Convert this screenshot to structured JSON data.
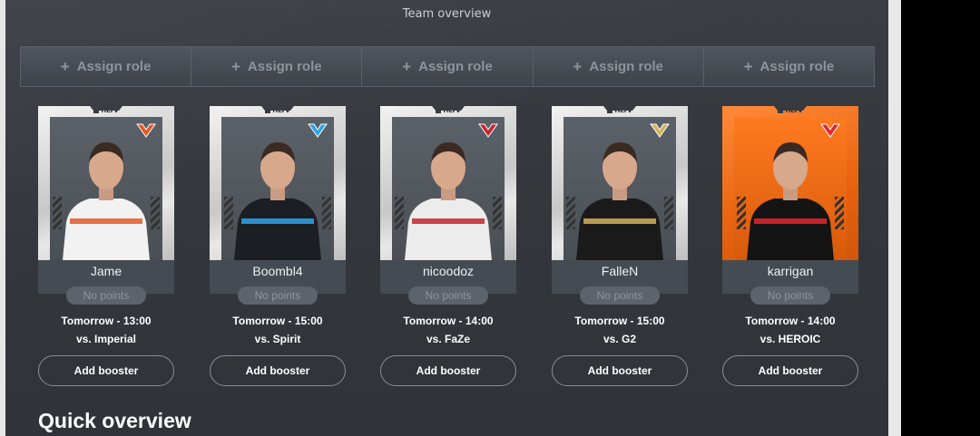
{
  "panel": {
    "title": "Team overview"
  },
  "roles": [
    {
      "label": "Assign role"
    },
    {
      "label": "Assign role"
    },
    {
      "label": "Assign role"
    },
    {
      "label": "Assign role"
    },
    {
      "label": "Assign role"
    }
  ],
  "players": [
    {
      "name": "Jame",
      "points": "No points",
      "time": "Tomorrow - 13:00",
      "opponent": "vs. Imperial",
      "booster": "Add booster",
      "logo": "virtus-pro-logo-icon",
      "badge": "HLTV",
      "shirt": "#f2f2f2",
      "accent": "#e05a2a",
      "card": "silver"
    },
    {
      "name": "Boombl4",
      "points": "No points",
      "time": "Tomorrow - 15:00",
      "opponent": "vs. Spirit",
      "booster": "Add booster",
      "logo": "cloud9-logo-icon",
      "badge": "HLTV",
      "shirt": "#1b1e23",
      "accent": "#2ea3e6",
      "card": "silver"
    },
    {
      "name": "nicoodoz",
      "points": "No points",
      "time": "Tomorrow - 14:00",
      "opponent": "vs. FaZe",
      "booster": "Add booster",
      "logo": "heroic-logo-icon",
      "badge": "HLTV",
      "shirt": "#ececec",
      "accent": "#c0282d",
      "card": "silver"
    },
    {
      "name": "FalleN",
      "points": "No points",
      "time": "Tomorrow - 15:00",
      "opponent": "vs. G2",
      "booster": "Add booster",
      "logo": "furia-logo-icon",
      "badge": "HLTV",
      "shirt": "#1a1a1a",
      "accent": "#d4b25a",
      "card": "silver"
    },
    {
      "name": "karrigan",
      "points": "No points",
      "time": "Tomorrow - 14:00",
      "opponent": "vs. HEROIC",
      "booster": "Add booster",
      "logo": "faze-logo-icon",
      "badge": "HLTV",
      "shirt": "#141414",
      "accent": "#e3262f",
      "card": "orange"
    }
  ],
  "quick_overview": {
    "title": "Quick overview"
  }
}
